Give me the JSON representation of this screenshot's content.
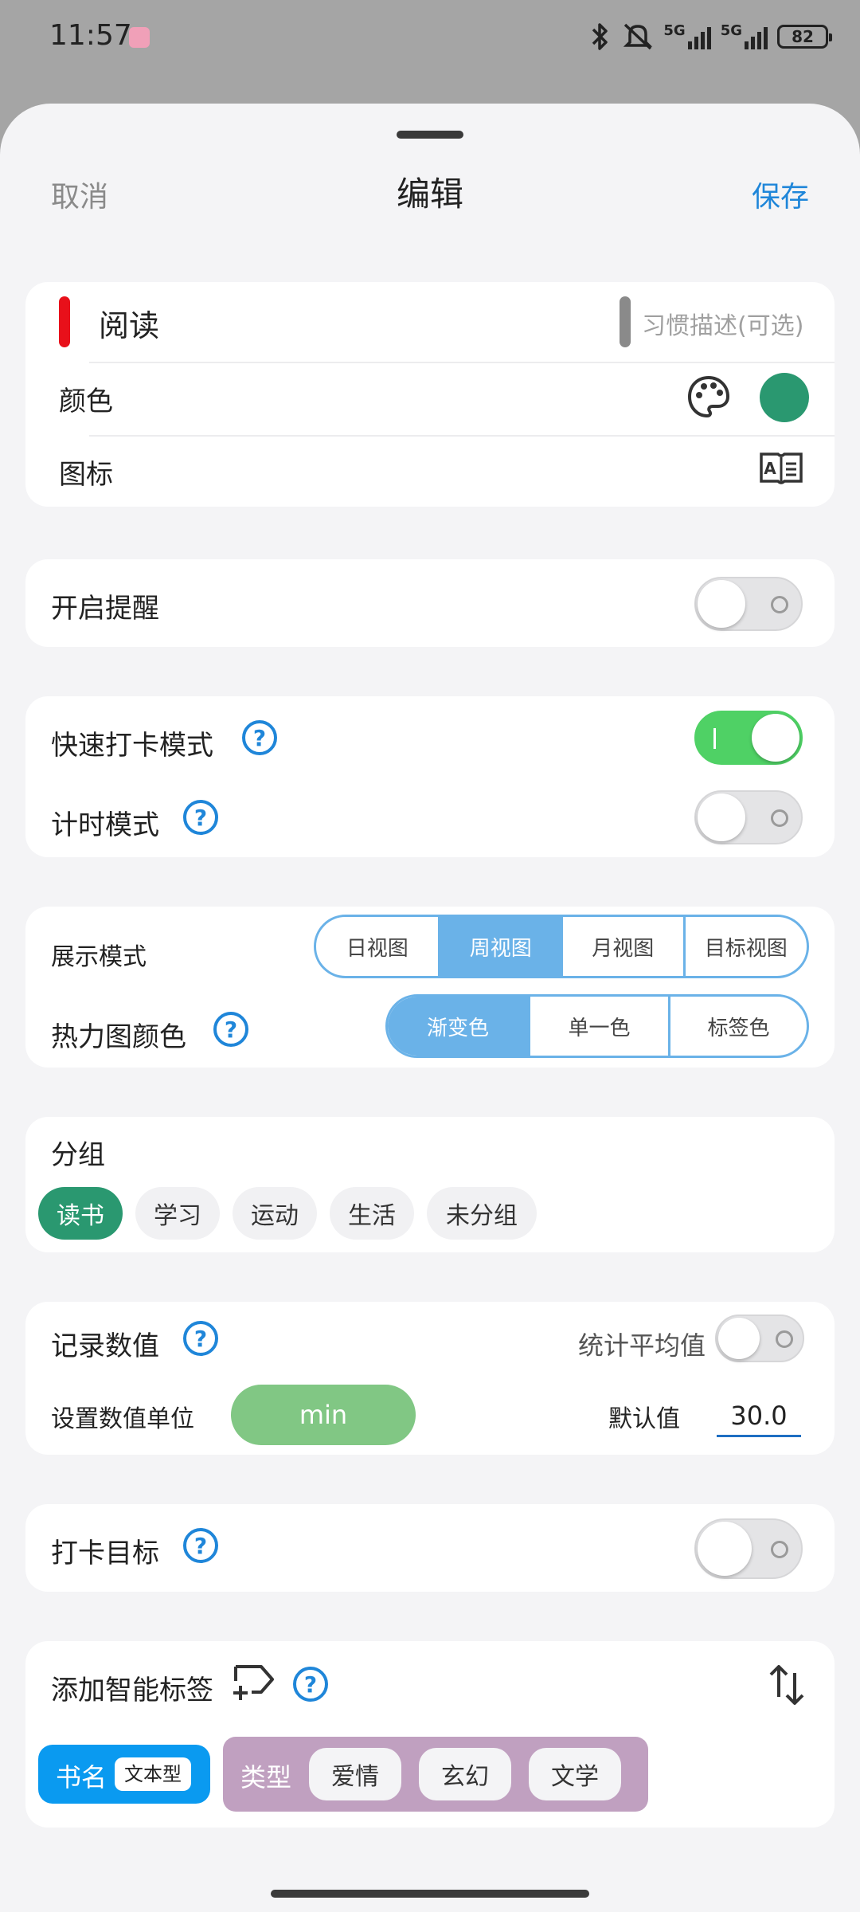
{
  "status_bar": {
    "time": "11:57",
    "battery": "82",
    "signal_1": "5G",
    "signal_2": "5G"
  },
  "header": {
    "cancel": "取消",
    "title": "编辑",
    "save": "保存"
  },
  "habit": {
    "name": "阅读",
    "description_placeholder": "习惯描述(可选)",
    "color_label": "颜色",
    "color_value": "#2a9870",
    "accent_bar_color": "#e8101a",
    "icon_label": "图标",
    "icon_name": "book-a-icon"
  },
  "reminder": {
    "label": "开启提醒",
    "enabled": false
  },
  "modes": {
    "quick_checkin_label": "快速打卡模式",
    "quick_checkin_enabled": true,
    "timer_label": "计时模式",
    "timer_enabled": false
  },
  "display": {
    "label": "展示模式",
    "options": [
      "日视图",
      "周视图",
      "月视图",
      "目标视图"
    ],
    "selected": "周视图",
    "heatmap_label": "热力图颜色",
    "heatmap_options": [
      "渐变色",
      "单一色",
      "标签色"
    ],
    "heatmap_selected": "渐变色"
  },
  "group": {
    "label": "分组",
    "chips": [
      "读书",
      "学习",
      "运动",
      "生活",
      "未分组"
    ],
    "selected": "读书"
  },
  "record": {
    "label": "记录数值",
    "average_label": "统计平均值",
    "average_enabled": false,
    "unit_label": "设置数值单位",
    "unit_value": "min",
    "default_label": "默认值",
    "default_value": "30.0"
  },
  "goal": {
    "label": "打卡目标",
    "enabled": false
  },
  "smart_tags": {
    "label": "添加智能标签",
    "tag1_name": "书名",
    "tag1_type": "文本型",
    "tag2_name": "类型",
    "tag2_options": [
      "爱情",
      "玄幻",
      "文学"
    ]
  }
}
